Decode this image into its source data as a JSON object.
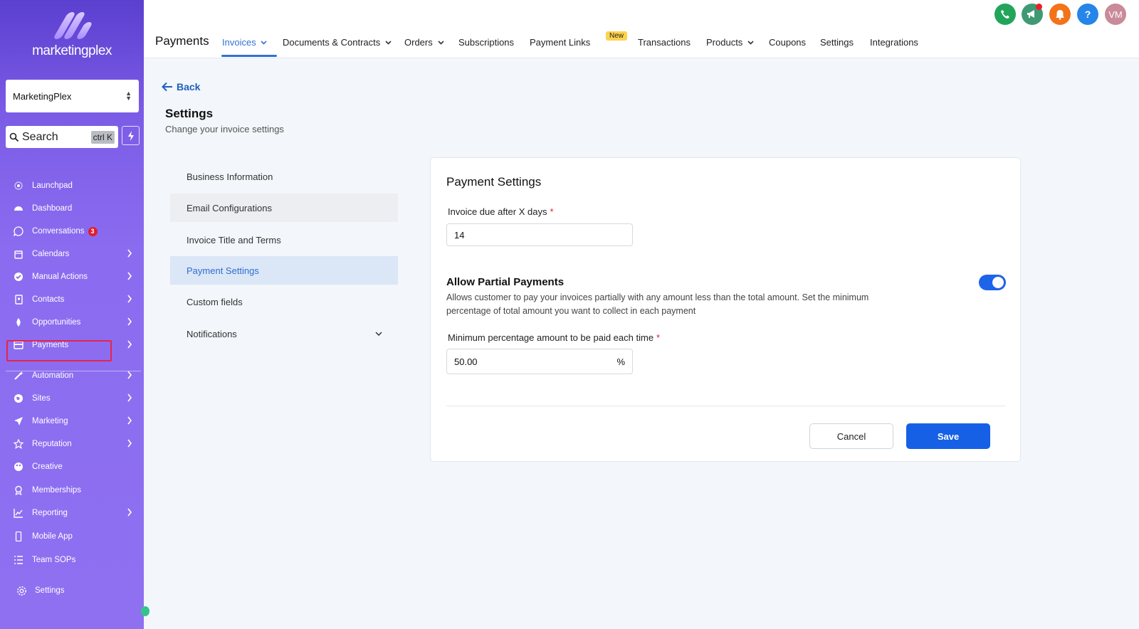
{
  "sidebar": {
    "brand": "marketingplex",
    "account": "MarketingPlex",
    "search": {
      "label": "Search",
      "shortcut": "ctrl K"
    },
    "items": [
      {
        "label": "Launchpad",
        "icon": "rocket-icon",
        "chevron": false
      },
      {
        "label": "Dashboard",
        "icon": "gauge-icon",
        "chevron": false
      },
      {
        "label": "Conversations",
        "icon": "chat-icon",
        "chevron": false,
        "badge": "3"
      },
      {
        "label": "Calendars",
        "icon": "calendar-icon",
        "chevron": true
      },
      {
        "label": "Manual Actions",
        "icon": "check-icon",
        "chevron": true
      },
      {
        "label": "Contacts",
        "icon": "contacts-icon",
        "chevron": true
      },
      {
        "label": "Opportunities",
        "icon": "filter-icon",
        "chevron": true
      },
      {
        "label": "Payments",
        "icon": "card-icon",
        "chevron": true
      },
      {
        "label": "Automation",
        "icon": "wand-icon",
        "chevron": true
      },
      {
        "label": "Sites",
        "icon": "globe-icon",
        "chevron": true
      },
      {
        "label": "Marketing",
        "icon": "send-icon",
        "chevron": true
      },
      {
        "label": "Reputation",
        "icon": "star-icon",
        "chevron": true
      },
      {
        "label": "Creative",
        "icon": "palette-icon",
        "chevron": false
      },
      {
        "label": "Memberships",
        "icon": "award-icon",
        "chevron": false
      },
      {
        "label": "Reporting",
        "icon": "chart-icon",
        "chevron": true
      },
      {
        "label": "Mobile App",
        "icon": "phone-icon",
        "chevron": false
      },
      {
        "label": "Team SOPs",
        "icon": "list-icon",
        "chevron": false
      }
    ],
    "settings": "Settings"
  },
  "topbar": {
    "title": "Payments",
    "tabs": [
      {
        "label": "Invoices",
        "dropdown": true,
        "active": true
      },
      {
        "label": "Documents & Contracts",
        "dropdown": true
      },
      {
        "label": "Orders",
        "dropdown": true
      },
      {
        "label": "Subscriptions"
      },
      {
        "label": "Payment Links"
      },
      {
        "label": "Transactions"
      },
      {
        "label": "Products",
        "dropdown": true
      },
      {
        "label": "Coupons"
      },
      {
        "label": "Settings"
      },
      {
        "label": "Integrations"
      }
    ],
    "new_badge": "New",
    "avatar_initials": "VM",
    "help": "?",
    "colors": {
      "phone": "#22a55a",
      "megaphone": "#3f9a73",
      "bell": "#f27318",
      "help": "#2585e8",
      "avatar": "#c98a9a"
    }
  },
  "content": {
    "back": "Back",
    "title": "Settings",
    "subtitle": "Change your invoice settings",
    "nav": [
      {
        "label": "Business Information"
      },
      {
        "label": "Email Configurations"
      },
      {
        "label": "Invoice Title and Terms"
      },
      {
        "label": "Payment Settings"
      },
      {
        "label": "Custom fields"
      },
      {
        "label": "Notifications"
      }
    ],
    "card": {
      "title": "Payment Settings",
      "due_label": "Invoice due after X days",
      "due_value": "14",
      "partial_title": "Allow Partial Payments",
      "partial_desc": "Allows customer to pay your invoices partially with any amount less than the total amount. Set the minimum percentage of total amount you want to collect in each payment",
      "partial_enabled": true,
      "min_label": "Minimum percentage amount to be paid each time",
      "min_value": "50.00",
      "min_suffix": "%",
      "cancel": "Cancel",
      "save": "Save",
      "required_mark": "*"
    }
  }
}
